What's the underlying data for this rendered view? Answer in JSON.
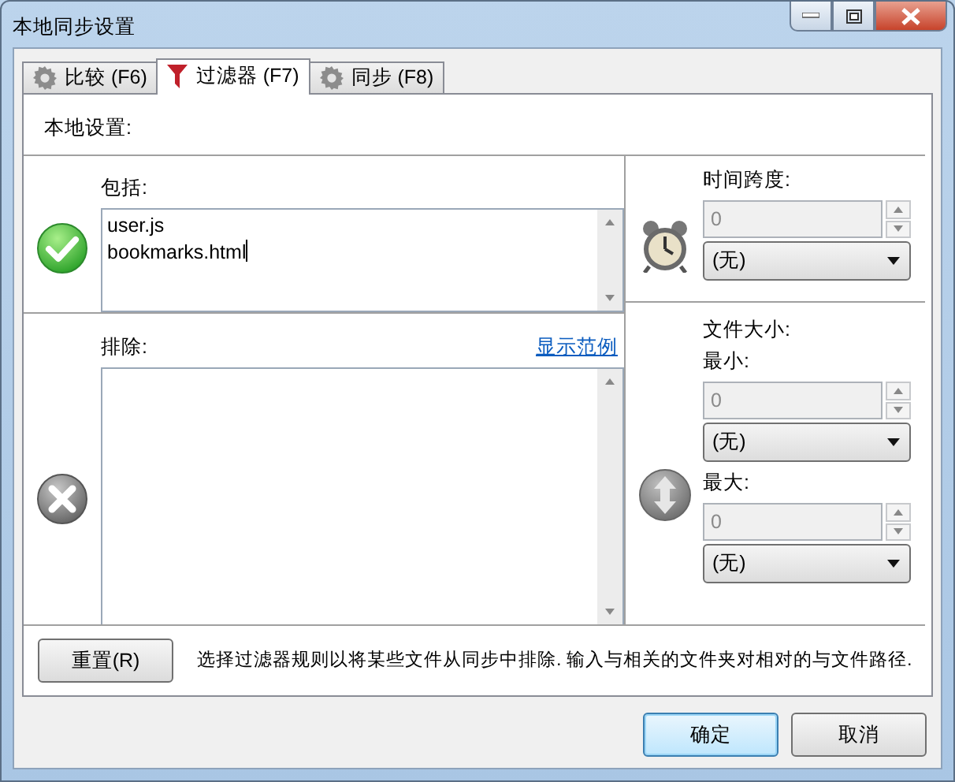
{
  "window": {
    "title": "本地同步设置"
  },
  "tabs": [
    {
      "label": "比较 (F6)",
      "kind": "gear",
      "selected": false
    },
    {
      "label": "过滤器 (F7)",
      "kind": "filter",
      "selected": true
    },
    {
      "label": "同步 (F8)",
      "kind": "gear",
      "selected": false
    }
  ],
  "section_title": "本地设置:",
  "include": {
    "label": "包括:",
    "lines": [
      "user.js",
      "bookmarks.html"
    ]
  },
  "exclude": {
    "label": "排除:",
    "link": "显示范例"
  },
  "time_span": {
    "label": "时间跨度:",
    "value": "0",
    "unit": "(无)",
    "disabled": true
  },
  "file_size": {
    "label": "文件大小:",
    "min": {
      "label": "最小:",
      "value": "0",
      "unit": "(无)",
      "disabled": true
    },
    "max": {
      "label": "最大:",
      "value": "0",
      "unit": "(无)",
      "disabled": true
    }
  },
  "reset_button": "重置(R)",
  "hint": "选择过滤器规则以将某些文件从同步中排除. 输入与相关的文件夹对相对的与文件路径.",
  "buttons": [
    {
      "label": "确定",
      "default": true
    },
    {
      "label": "取消",
      "default": false
    }
  ]
}
